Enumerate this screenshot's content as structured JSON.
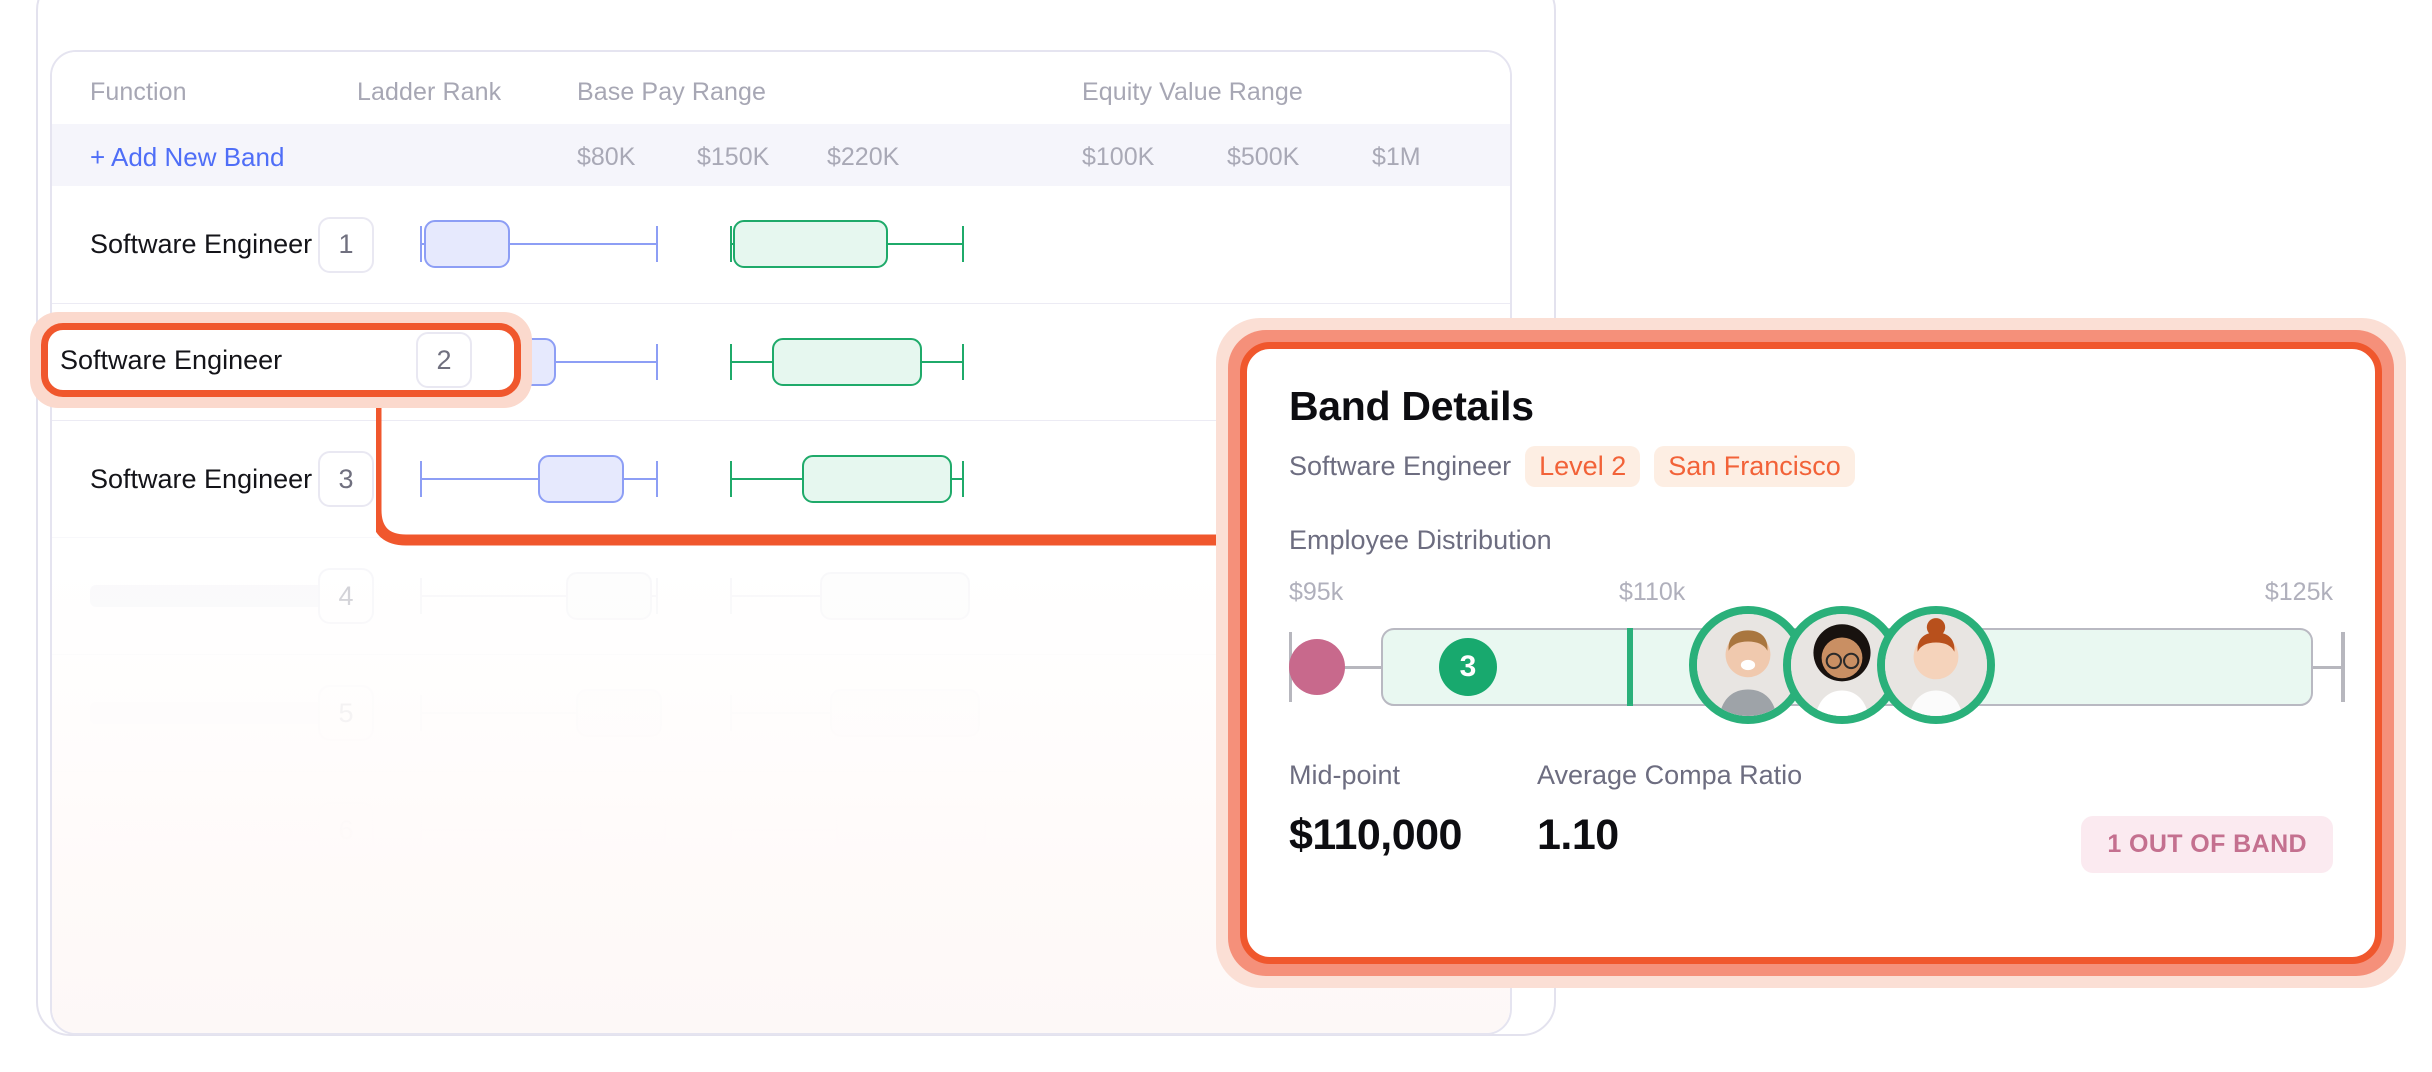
{
  "table": {
    "headers": {
      "function": "Function",
      "ladder_rank": "Ladder Rank",
      "base_pay_range": "Base Pay Range",
      "equity_value_range": "Equity Value Range"
    },
    "add_band_label": "+ Add New Band",
    "base_ticks": [
      "$80K",
      "$150K",
      "$220K"
    ],
    "equity_ticks": [
      "$100K",
      "$500K",
      "$1M"
    ],
    "rows": [
      {
        "function": "Software Engineer",
        "rank": "1",
        "state": "normal"
      },
      {
        "function": "Software Engineer",
        "rank": "2",
        "state": "selected"
      },
      {
        "function": "Software Engineer",
        "rank": "3",
        "state": "normal"
      },
      {
        "function": "",
        "rank": "4",
        "state": "dim-1"
      },
      {
        "function": "",
        "rank": "5",
        "state": "dim-2"
      },
      {
        "function": "",
        "rank": "6",
        "state": "dim-3"
      }
    ]
  },
  "panel": {
    "title": "Band Details",
    "role": "Software Engineer",
    "level_chip": "Level 2",
    "location_chip": "San Francisco",
    "distribution_label": "Employee Distribution",
    "scale": {
      "min": "$95k",
      "mid": "$110k",
      "max": "$125k"
    },
    "in_band_count": "3",
    "avatars": [
      "avatar-employee-1",
      "avatar-employee-2",
      "avatar-employee-3"
    ],
    "metrics": [
      {
        "label": "Mid-point",
        "value": "$110,000"
      },
      {
        "label": "Average Compa Ratio",
        "value": "1.10"
      }
    ],
    "out_of_band_badge": "1 OUT OF BAND"
  },
  "colors": {
    "accent_orange": "#f0572d",
    "band_green": "#2ab07a",
    "plot_blue": "#8d9ef5",
    "plot_green": "#1faa6a",
    "out_of_band_pink": "#c8698c",
    "link_blue": "#4f6ef7"
  },
  "chart_data": {
    "type": "bar",
    "title": "Employee Distribution",
    "xlabel": "",
    "ylabel": "",
    "categories": [
      "$95k",
      "$110k",
      "$125k"
    ],
    "values": [
      0,
      3,
      0
    ],
    "xlim": [
      95000,
      125000
    ],
    "annotations": [
      "1 OUT OF BAND",
      "3 in band"
    ]
  }
}
